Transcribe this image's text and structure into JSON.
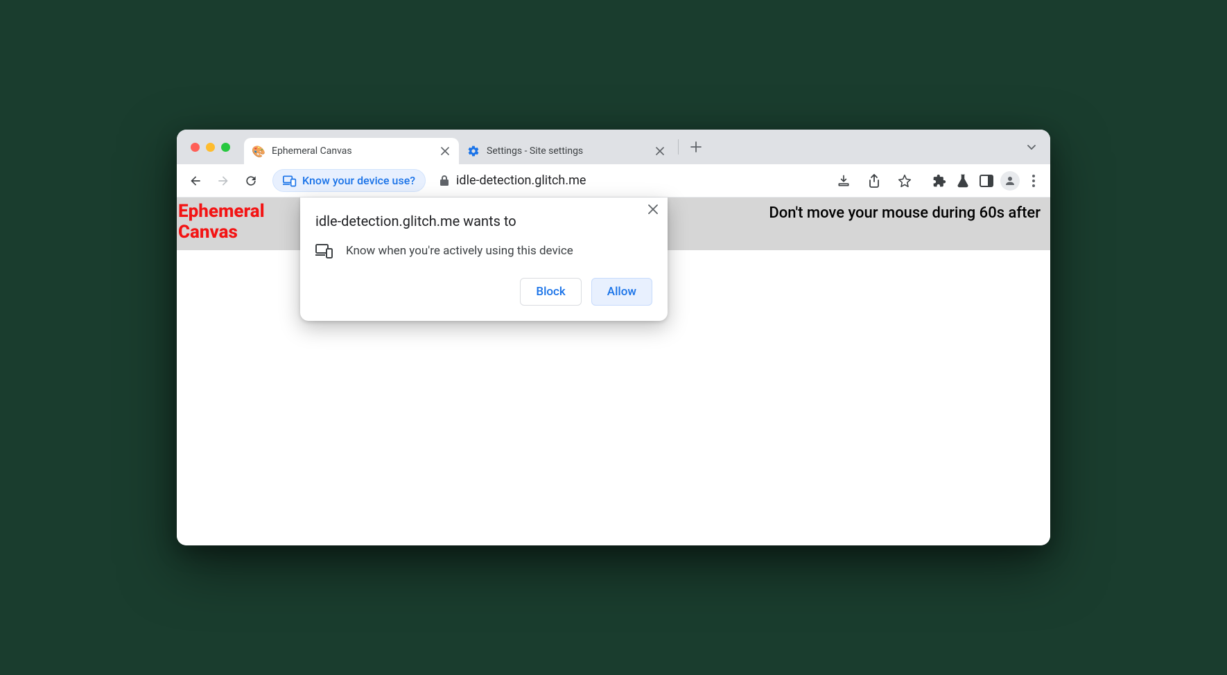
{
  "tabs": [
    {
      "title": "Ephemeral Canvas",
      "favicon": "emoji"
    },
    {
      "title": "Settings - Site settings",
      "favicon": "gear"
    }
  ],
  "chip": {
    "label": "Know your device use?"
  },
  "omnibox": {
    "url": "idle-detection.glitch.me"
  },
  "page": {
    "title_line1": "Ephemeral",
    "title_line2": "Canvas",
    "message": "Don't move your mouse during 60s after"
  },
  "prompt": {
    "title": "idle-detection.glitch.me wants to",
    "permission_text": "Know when you're actively using this device",
    "block": "Block",
    "allow": "Allow"
  }
}
